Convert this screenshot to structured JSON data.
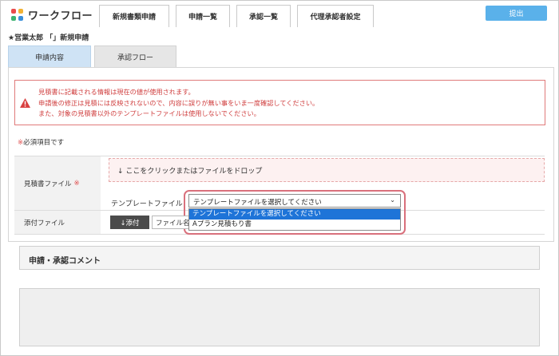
{
  "app": {
    "title": "ワークフロー",
    "logo_colors": [
      "#e94b4b",
      "#f2b233",
      "#3cb371",
      "#3a8fd9"
    ]
  },
  "nav": {
    "tabs": [
      {
        "label": "新規書類申請"
      },
      {
        "label": "申請一覧"
      },
      {
        "label": "承認一覧"
      },
      {
        "label": "代理承認者設定"
      }
    ],
    "submit_label": "提出"
  },
  "page": {
    "title": "★営業太郎 「」新規申請"
  },
  "subtabs": {
    "active_label": "申請内容",
    "inactive_label": "承認フロー"
  },
  "warning": {
    "line1": "見積書に記載される情報は現在の値が使用されます。",
    "line2": "申請後の修正は見積には反映されないので、内容に誤りが無い事をいま一度確認してください。",
    "line3": "また、対象の見積書以外のテンプレートファイルは使用しないでください。"
  },
  "form": {
    "required_mark": "※",
    "required_note": "必須項目です",
    "file_label": "見積書ファイル",
    "file_required_mark": "※",
    "drop_text": "↓ ここをクリックまたはファイルをドロップ",
    "template_label": "テンプレートファイル",
    "template_selected": "テンプレートファイルを選択してください",
    "template_options": [
      "テンプレートファイルを選択してください",
      "Aプラン見積もり書"
    ],
    "attach_label": "添付ファイル",
    "attach_button": "↓添付",
    "attach_input_value": "ファイル名"
  },
  "comment": {
    "title": "申請・承認コメント",
    "value": ""
  },
  "colors": {
    "accent": "#5ab1ea",
    "warning": "#d04040",
    "selected_option": "#1e74d8",
    "active_subtab": "#cfe3f5"
  }
}
